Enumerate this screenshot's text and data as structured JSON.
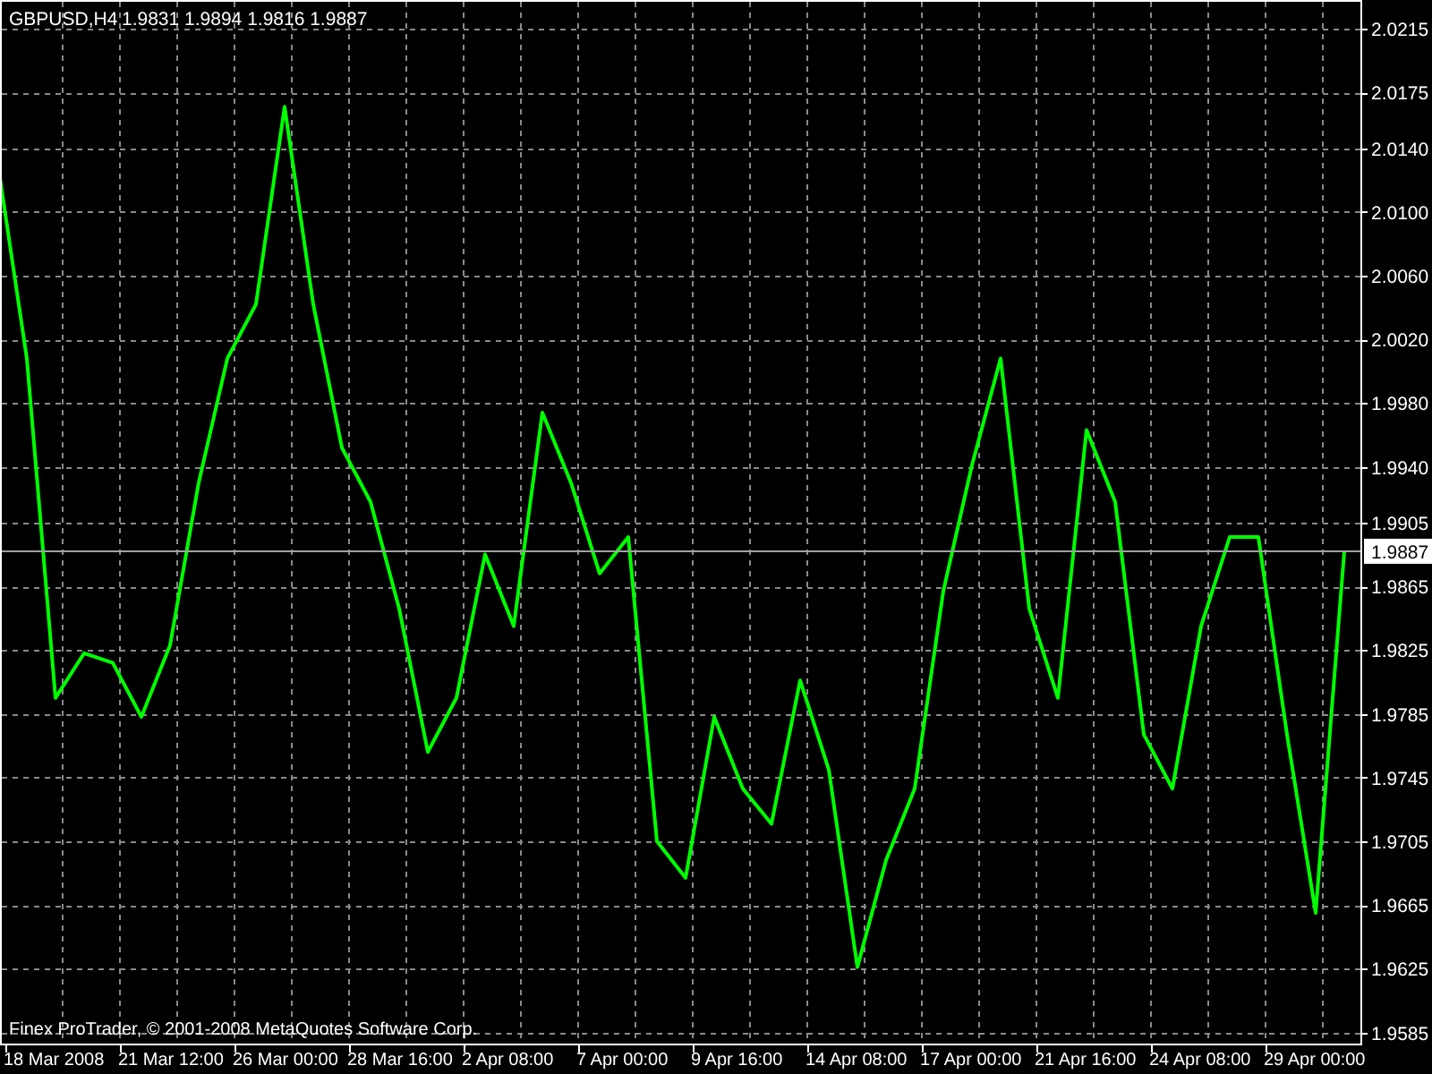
{
  "chart": {
    "quote": "1.9831 1.9894 1.9816 1.9887",
    "footer": "Finex ProTrader, © 2001-2008 MetaQuotes Software Corp.",
    "chart_data": {
      "type": "line",
      "title": "GBPUSD,H4",
      "grid": true,
      "categories": [
        null,
        null,
        "18 Mar 2008",
        null,
        null,
        null,
        "21 Mar 12:00",
        null,
        null,
        null,
        "26 Mar 00:00",
        null,
        null,
        null,
        "28 Mar 16:00",
        null,
        null,
        null,
        "2 Apr 08:00",
        null,
        null,
        null,
        "7 Apr 00:00",
        null,
        null,
        null,
        "9 Apr 16:00",
        null,
        null,
        null,
        "14 Apr 08:00",
        null,
        null,
        null,
        "17 Apr 00:00",
        null,
        null,
        null,
        "21 Apr 16:00",
        null,
        null,
        null,
        "24 Apr 08:00",
        null,
        null,
        null,
        "29 Apr 00:00",
        null
      ],
      "series": [
        {
          "color": "#00ff00",
          "values": [
            2.0121,
            2.0008,
            1.9795,
            1.9823,
            1.9817,
            1.9783,
            1.9828,
            1.993,
            2.0008,
            2.0042,
            2.0166,
            2.0042,
            1.9952,
            1.9918,
            1.9851,
            1.9761,
            1.9795,
            1.9885,
            1.984,
            1.9974,
            1.993,
            1.9873,
            1.9896,
            1.9705,
            1.9682,
            1.9783,
            1.9738,
            1.9716,
            1.9806,
            1.975,
            1.9626,
            1.9693,
            1.9738,
            1.9862,
            1.9941,
            2.0008,
            1.9851,
            1.9795,
            1.9963,
            1.9918,
            1.9772,
            1.9738,
            1.984,
            1.9896,
            1.9896,
            1.9772,
            1.966,
            1.9887
          ]
        }
      ],
      "ylim": [
        1.9578,
        2.0233
      ],
      "yticks": [
        {
          "value": 2.0215,
          "label": "2.0215"
        },
        {
          "value": 2.0175,
          "label": "2.0175"
        },
        {
          "value": 2.014,
          "label": "2.0140"
        },
        {
          "value": 2.01,
          "label": "2.0100"
        },
        {
          "value": 2.006,
          "label": "2.0060"
        },
        {
          "value": 2.002,
          "label": "2.0020"
        },
        {
          "value": 1.998,
          "label": "1.9980"
        },
        {
          "value": 1.994,
          "label": "1.9940"
        },
        {
          "value": 1.9905,
          "label": "1.9905"
        },
        {
          "value": 1.9865,
          "label": "1.9865"
        },
        {
          "value": 1.9825,
          "label": "1.9825"
        },
        {
          "value": 1.9785,
          "label": "1.9785"
        },
        {
          "value": 1.9745,
          "label": "1.9745"
        },
        {
          "value": 1.9705,
          "label": "1.9705"
        },
        {
          "value": 1.9665,
          "label": "1.9665"
        },
        {
          "value": 1.9625,
          "label": "1.9625"
        },
        {
          "value": 1.9585,
          "label": "1.9585"
        }
      ],
      "ref_lines": [
        {
          "axis": "y",
          "value": 1.9887,
          "label": "1.9887"
        }
      ]
    }
  }
}
